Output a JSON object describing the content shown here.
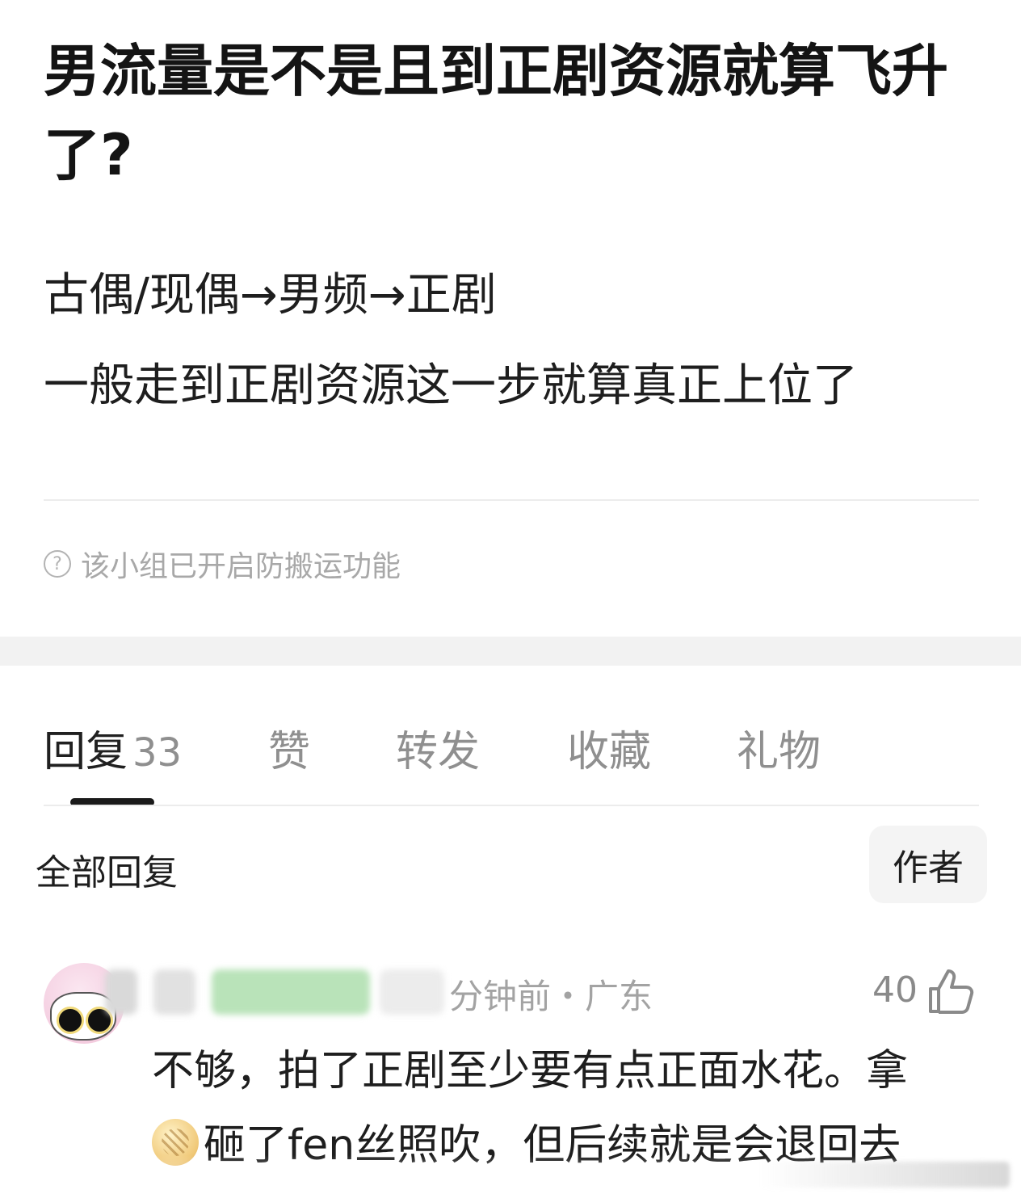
{
  "post": {
    "title": "男流量是不是且到正剧资源就算飞升了?",
    "body_lines": [
      "古偶/现偶→男频→正剧",
      "一般走到正剧资源这一步就算真正上位了"
    ],
    "notice": "该小组已开启防搬运功能"
  },
  "tabs": [
    {
      "label": "回复",
      "count": "33",
      "active": true
    },
    {
      "label": "赞"
    },
    {
      "label": "转发"
    },
    {
      "label": "收藏"
    },
    {
      "label": "礼物"
    }
  ],
  "filter": {
    "label": "全部回复",
    "author_button": "作者"
  },
  "comment": {
    "meta": "分钟前・广东",
    "likes": "40",
    "lines": [
      "不够，拍了正剧至少要有点正面水花。拿",
      "砸了fen丝照吹，但后续就是会退回去"
    ],
    "emoji": "coin-emoji"
  },
  "colors": {
    "background": "#ffffff",
    "text": "#1f1f1f",
    "muted": "#a3a3a3",
    "section_band": "#f2f2f2",
    "active_indicator": "#1a1a1a"
  }
}
